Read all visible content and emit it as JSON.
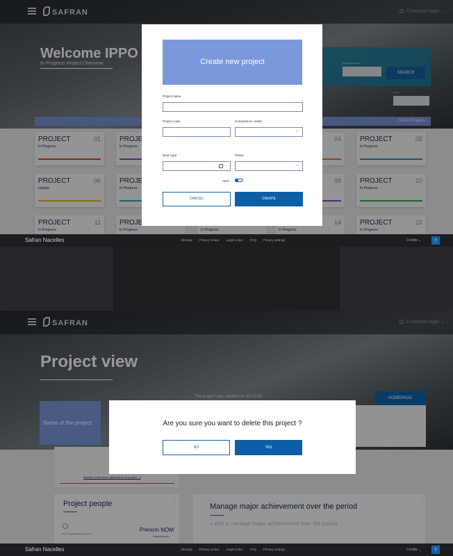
{
  "header": {
    "brand": "SAFRAN",
    "login": "Customer login"
  },
  "home": {
    "welcome_title": "Welcome IPPO",
    "welcome_sub": "In Progress Project Overview",
    "search_label": "SEARCH",
    "competence_label": "Competence center",
    "sort_label": "Sort by",
    "projects_count": "30/30 Projects",
    "cards": [
      {
        "title": "PROJECT",
        "num": "01",
        "status": "In Progress",
        "color": "#d64040"
      },
      {
        "title": "PROJEC",
        "num": "",
        "status": "In Progress",
        "color": "#7a4bb3"
      },
      {
        "title": "PROJECT",
        "num": "04",
        "status": "In Progress",
        "color": "#e07a2b"
      },
      {
        "title": "PROJECT",
        "num": "05",
        "status": "In Progress",
        "color": "#3a7fc4"
      },
      {
        "title": "PROJECT",
        "num": "06",
        "status": "Update",
        "color": "#e3b72b"
      },
      {
        "title": "PROJEC",
        "num": "",
        "status": "In Progress",
        "color": "#2fa0a8"
      },
      {
        "title": "PROJECT",
        "num": "09",
        "status": "In Progress",
        "color": "#7a4bb3"
      },
      {
        "title": "PROJECT",
        "num": "10",
        "status": "In Progress",
        "color": "#2fa84f"
      },
      {
        "title": "PROJECT",
        "num": "11",
        "status": "In Progress",
        "color": "#888888"
      },
      {
        "title": "PROJEC",
        "num": "",
        "status": "In Progress",
        "color": "#888888"
      },
      {
        "title": "",
        "num": "",
        "status": "In Progress",
        "color": "#888888"
      },
      {
        "title": "",
        "num": "14",
        "status": "In Progress",
        "color": "#888888"
      },
      {
        "title": "PROJECT",
        "num": "15",
        "status": "In Progress",
        "color": "#888888"
      }
    ]
  },
  "create_modal": {
    "title": "Create new project",
    "project_name_label": "Project name",
    "project_code_label": "Project code",
    "competence_center_label": "Competence center",
    "next_copil_label": "Next copil",
    "phase_label": "Phase",
    "alert_label": "Alert",
    "cancel": "CANCEL",
    "create": "CREATE"
  },
  "project_view": {
    "title": "Project view",
    "created_text": "The project was created on 05/12/20",
    "homepage": "HOMEPAGE",
    "name_of_project": "Name of the project",
    "members_text": "Number of members attached to the project : 3",
    "people_title": "Project people",
    "person_email": "prenom.nom@safrangroup.com",
    "person_name": "Prénom NOM",
    "person_role": "Administrator",
    "achievement_title": "Manage major achievement over the period",
    "achievement_add": "+ Add a manage major achievement over the period"
  },
  "delete_modal": {
    "question": "Are you sure you want to delete this project ?",
    "no": "NO",
    "yes": "YES"
  },
  "footer": {
    "brand": "Safran Nacelles",
    "links": [
      "Sitemap",
      "Privacy review",
      "Legal notice",
      "FAQ",
      "Privacy settings"
    ],
    "credits": "Credits"
  }
}
